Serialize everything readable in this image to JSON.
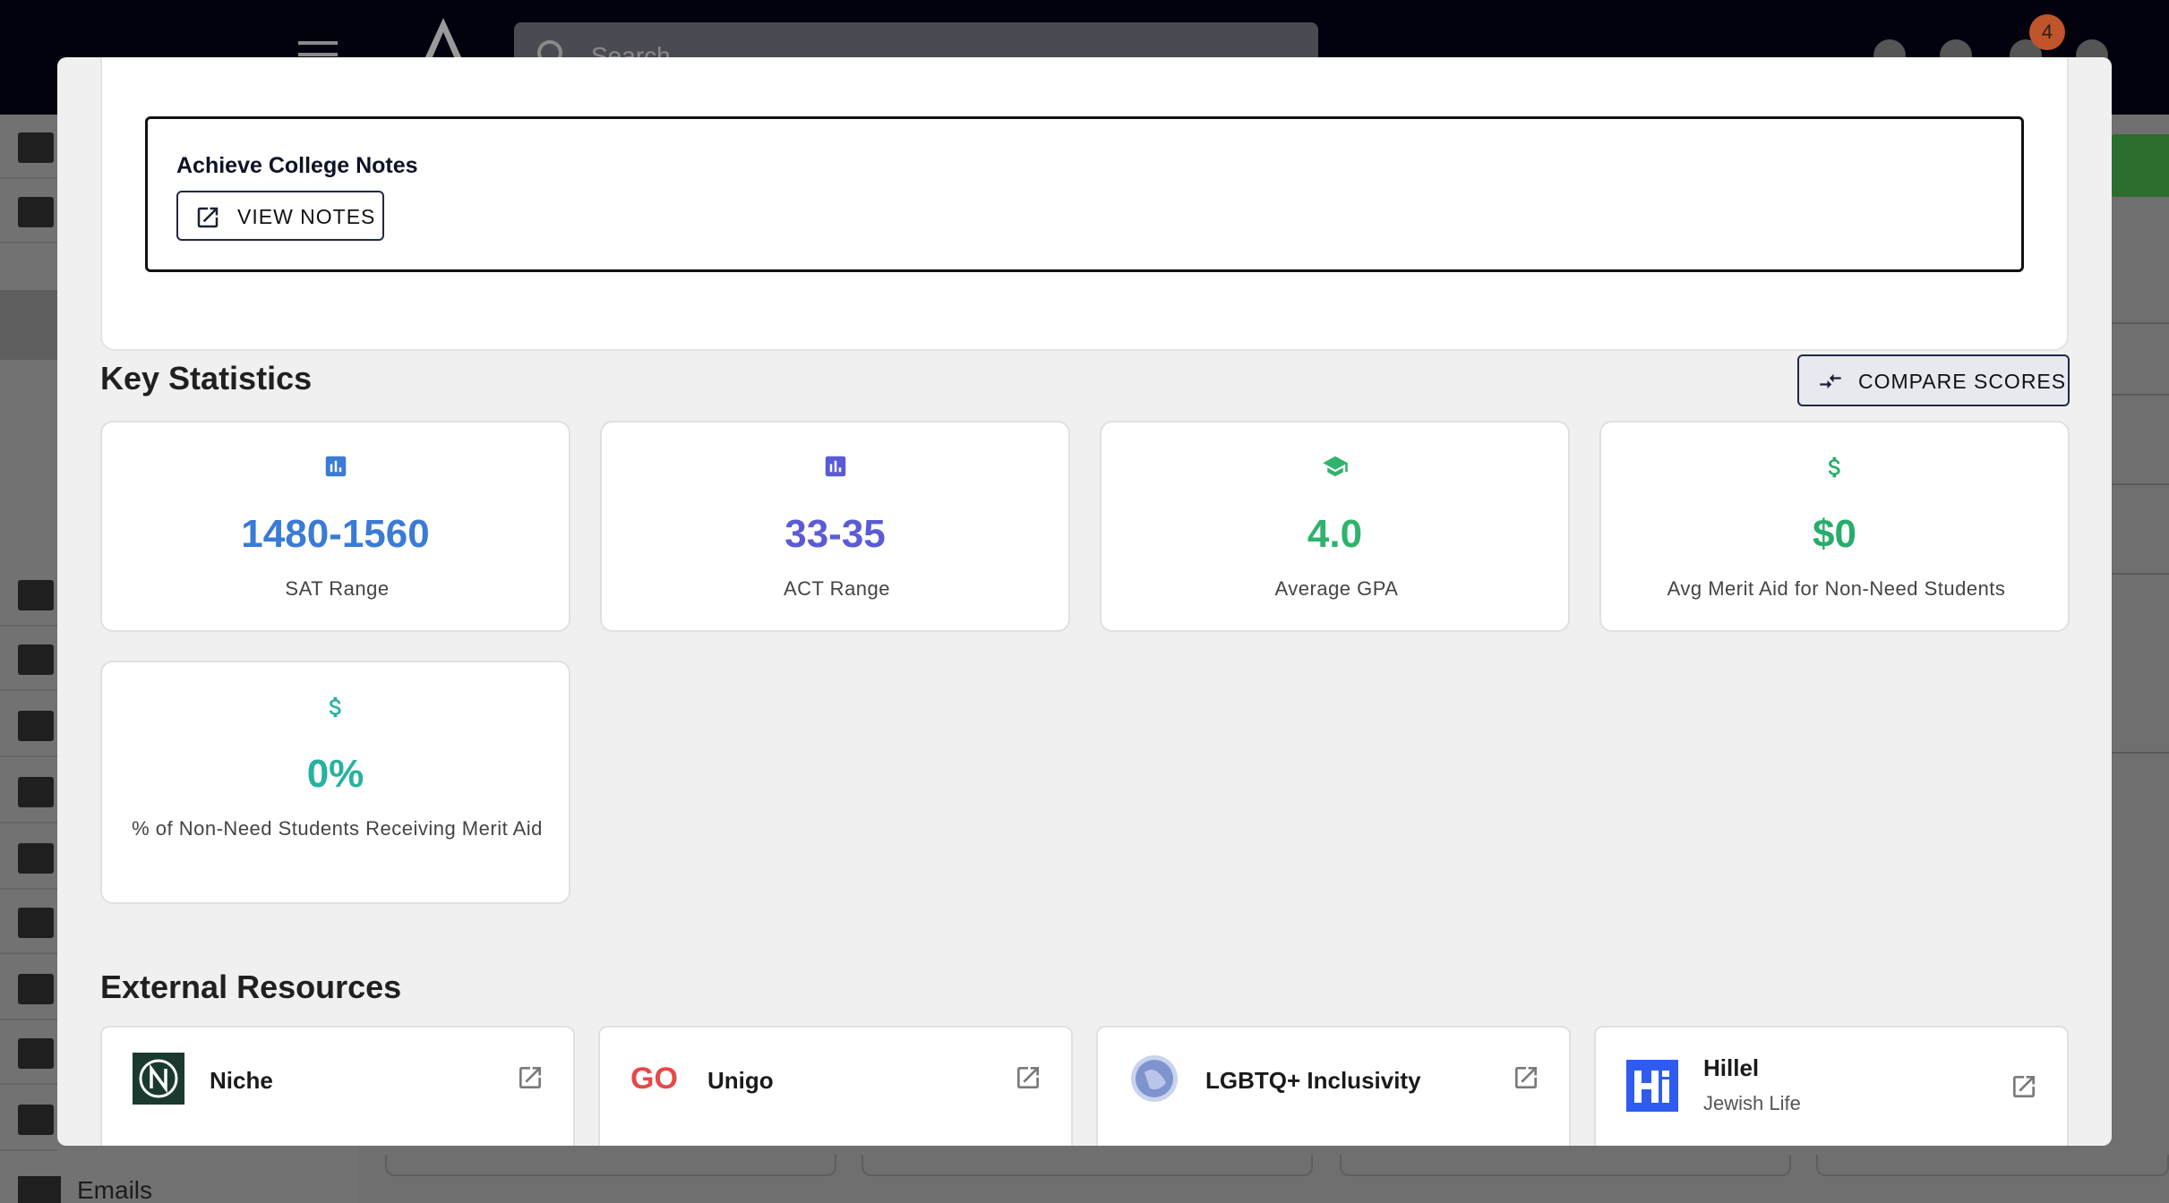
{
  "topbar": {
    "search_placeholder": "Search",
    "notification_count": "4"
  },
  "sidebar": {
    "emails_label": "Emails"
  },
  "notes": {
    "title": "Achieve College Notes",
    "view_notes_label": "VIEW NOTES"
  },
  "key_statistics": {
    "title": "Key Statistics",
    "compare_label": "COMPARE SCORES",
    "cards": [
      {
        "value": "1480-1560",
        "label": "SAT Range",
        "icon": "bar-chart-icon",
        "color": "#3a7bd5"
      },
      {
        "value": "33-35",
        "label": "ACT Range",
        "icon": "bar-chart-icon",
        "color": "#5b5bd6"
      },
      {
        "value": "4.0",
        "label": "Average GPA",
        "icon": "graduation-cap-icon",
        "color": "#2fb36d"
      },
      {
        "value": "$0",
        "label": "Avg Merit Aid for Non-Need Students",
        "icon": "dollar-icon",
        "color": "#27ad6b"
      },
      {
        "value": "0%",
        "label": "% of Non-Need Students Receiving Merit Aid",
        "icon": "dollar-icon",
        "color": "#26b2a0"
      }
    ]
  },
  "external_resources": {
    "title": "External Resources",
    "items": [
      {
        "name": "Niche",
        "sub": "",
        "logo": "niche-logo"
      },
      {
        "name": "Unigo",
        "sub": "",
        "logo": "unigo-logo"
      },
      {
        "name": "LGBTQ+ Inclusivity",
        "sub": "",
        "logo": "globe-logo"
      },
      {
        "name": "Hillel",
        "sub": "Jewish Life",
        "logo": "hillel-logo"
      }
    ]
  }
}
